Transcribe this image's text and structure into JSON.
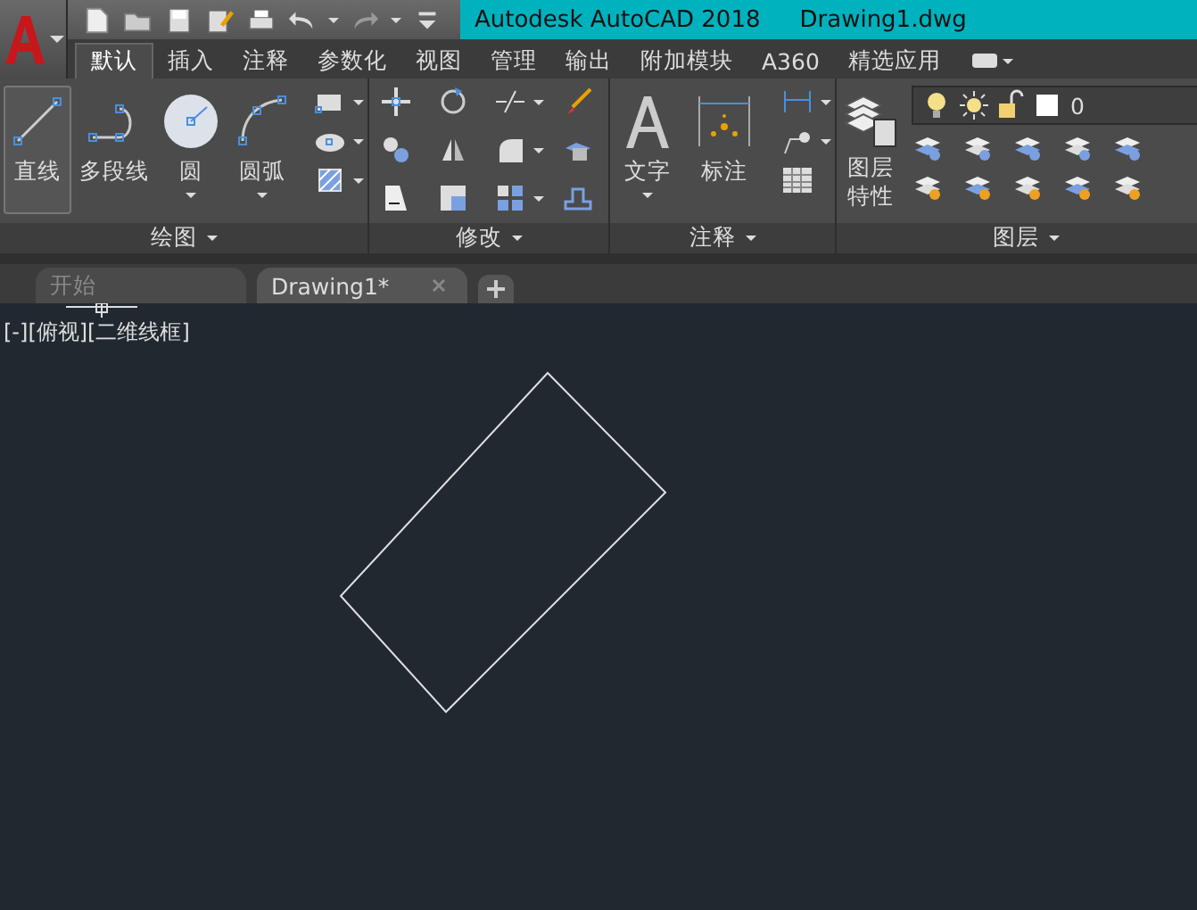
{
  "title_bar": {
    "app": "Autodesk AutoCAD 2018",
    "file": "Drawing1.dwg"
  },
  "ribbon_tabs": [
    {
      "label": "默认",
      "selected": true
    },
    {
      "label": "插入",
      "selected": false
    },
    {
      "label": "注释",
      "selected": false
    },
    {
      "label": "参数化",
      "selected": false
    },
    {
      "label": "视图",
      "selected": false
    },
    {
      "label": "管理",
      "selected": false
    },
    {
      "label": "输出",
      "selected": false
    },
    {
      "label": "附加模块",
      "selected": false
    },
    {
      "label": "A360",
      "selected": false
    },
    {
      "label": "精选应用",
      "selected": false
    }
  ],
  "panels": [
    {
      "title": "绘图",
      "tools": [
        {
          "label": "直线",
          "selected": true
        },
        {
          "label": "多段线",
          "selected": false
        },
        {
          "label": "圆",
          "selected": false
        },
        {
          "label": "圆弧",
          "selected": false
        }
      ]
    },
    {
      "title": "修改"
    },
    {
      "title": "注释",
      "tools": [
        {
          "label": "文字",
          "selected": false
        },
        {
          "label": "标注",
          "selected": false
        }
      ]
    },
    {
      "title": "图层",
      "tools": [
        {
          "label": "图层特性",
          "selected": false
        }
      ],
      "layer_control": "0"
    }
  ],
  "doc_tabs": [
    {
      "label": "开始",
      "selected": false
    },
    {
      "label": "Drawing1*",
      "selected": true
    }
  ],
  "viewport_label": "[-][俯视][二维线框]"
}
